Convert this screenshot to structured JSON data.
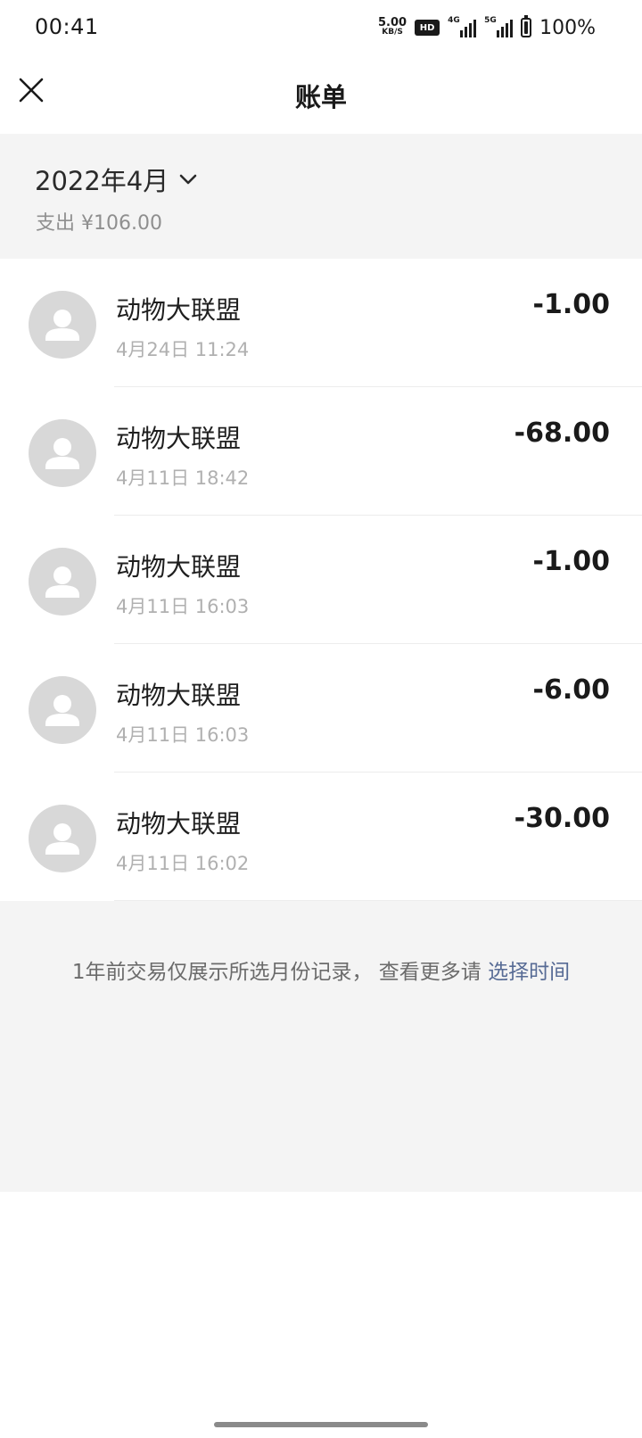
{
  "status_bar": {
    "time": "00:41",
    "net_speed_value": "5.00",
    "net_speed_unit": "KB/S",
    "hd_label": "HD",
    "signal1_tag": "4G",
    "signal2_tag": "5G",
    "battery_percent": "100%"
  },
  "header": {
    "title": "账单",
    "close_icon": "close-icon"
  },
  "month_header": {
    "month": "2022年4月",
    "summary": "支出 ¥106.00"
  },
  "transactions": [
    {
      "merchant": "动物大联盟",
      "time": "4月24日 11:24",
      "amount": "-1.00"
    },
    {
      "merchant": "动物大联盟",
      "time": "4月11日 18:42",
      "amount": "-68.00"
    },
    {
      "merchant": "动物大联盟",
      "time": "4月11日 16:03",
      "amount": "-1.00"
    },
    {
      "merchant": "动物大联盟",
      "time": "4月11日 16:03",
      "amount": "-6.00"
    },
    {
      "merchant": "动物大联盟",
      "time": "4月11日 16:02",
      "amount": "-30.00"
    }
  ],
  "footer": {
    "note": "1年前交易仅展示所选月份记录， 查看更多请 ",
    "link": "选择时间"
  },
  "colors": {
    "link": "#576b95",
    "background_gray": "#f4f4f4",
    "avatar_gray": "#d8d8d8"
  }
}
